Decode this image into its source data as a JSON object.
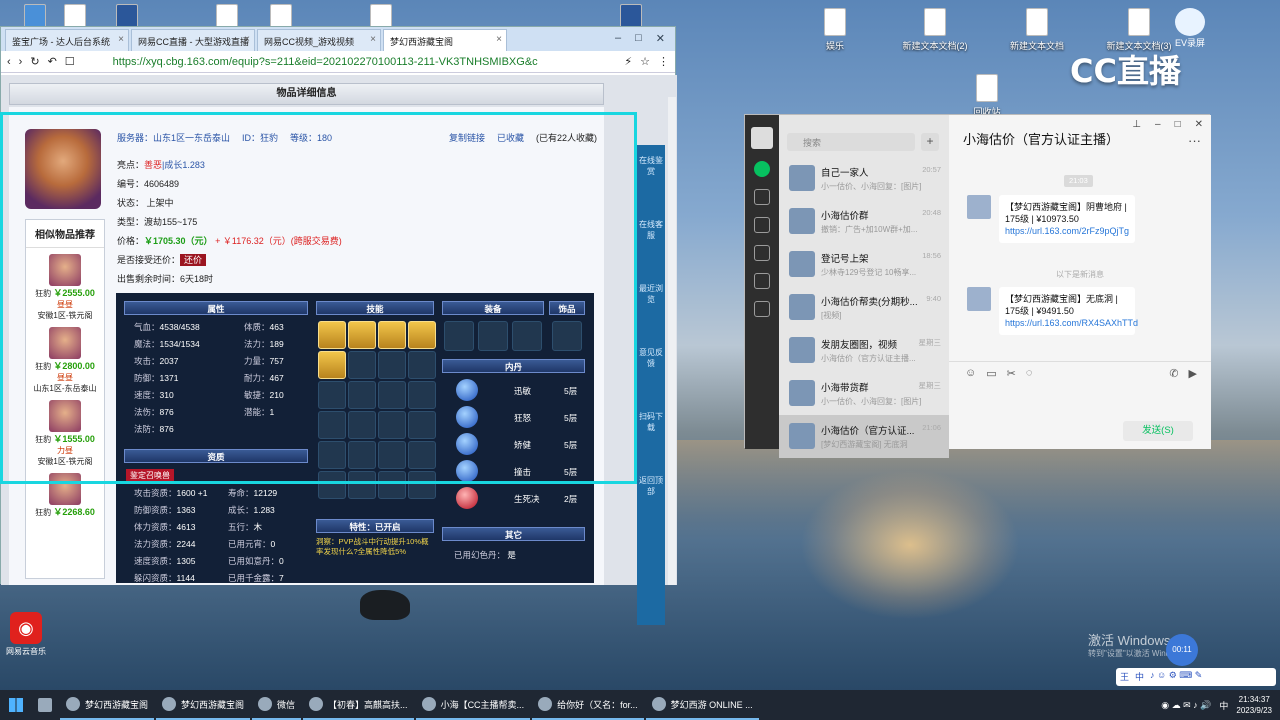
{
  "desktop": {
    "icons": [
      {
        "label": "",
        "x_note": "top-left row"
      },
      {
        "label": "娱乐"
      },
      {
        "label": "新建文本文档(2)"
      },
      {
        "label": "新建文本文档"
      },
      {
        "label": "新建文本文档(3)"
      },
      {
        "label": "EV录屏"
      },
      {
        "label": "回收站"
      }
    ],
    "cc_watermark": "CC直播",
    "netease_label": "网易云音乐",
    "activate_title": "激活 Windows",
    "activate_sub": "转到\"设置\"以激活 Windows。",
    "timer": "00:11"
  },
  "browser": {
    "tabs": [
      {
        "label": "鉴宝广场 - 达人后台系统"
      },
      {
        "label": "网易CC直播 - 大型游戏直播"
      },
      {
        "label": "网易CC视频_游戏视频"
      },
      {
        "label": "梦幻西游藏宝阁"
      }
    ],
    "url": "https://xyq.cbg.163.com/equip?s=211&eid=202102270100113-211-VK3TNHSMIBXG&c",
    "page_title": "物品详细信息",
    "server": "服务器：山东1区一东岳泰山",
    "id": "ID：狂豹",
    "level": "等级：180",
    "copy_link": "复制链接",
    "collected": "已收藏",
    "collect_count": "(已有22人收藏)",
    "highlight_label": "亮点：",
    "highlight_a": "善恶",
    "highlight_b": "|成长1.283",
    "code": "编号：4606489",
    "status": "状态：  上架中",
    "type": "类型：渡劫155~175",
    "price_label": "价格：",
    "price_main": "￥1705.30（元）",
    "price_plus": "+",
    "price_extra": "￥1176.32（元）(跨服交易费)",
    "bargain_label": "是否接受还价：",
    "bargain_btn": "还价",
    "remain": "出售剩余时间：6天18时",
    "similar": {
      "title": "相似物品推荐",
      "items": [
        {
          "name": "狂豹",
          "price": "￥2555.00",
          "tag": "昼昼",
          "server": "安徽1区-铁元阁"
        },
        {
          "name": "狂豹",
          "price": "￥2800.00",
          "tag": "昼昼",
          "server": "山东1区-东岳泰山"
        },
        {
          "name": "狂豹",
          "price": "￥1555.00",
          "tag": "力昼",
          "server": "安徽1区-铁元阁"
        },
        {
          "name": "狂豹",
          "price": "￥2268.60",
          "tag": "",
          "server": ""
        }
      ]
    },
    "panel": {
      "attr_head": "属性",
      "skill_head": "技能",
      "equip_head": "装备",
      "ornament_head": "饰品",
      "neidan_head": "内丹",
      "zizhi_head": "资质",
      "trait_head": "特性：已开启",
      "other_head": "其它",
      "attrs": [
        {
          "k": "气血：",
          "v": "4538/4538",
          "k2": "体质：",
          "v2": "463"
        },
        {
          "k": "魔法：",
          "v": "1534/1534",
          "k2": "法力：",
          "v2": "189"
        },
        {
          "k": "攻击：",
          "v": "2037",
          "k2": "力量：",
          "v2": "757"
        },
        {
          "k": "防御：",
          "v": "1371",
          "k2": "耐力：",
          "v2": "467"
        },
        {
          "k": "速度：",
          "v": "310",
          "k2": "敏捷：",
          "v2": "210"
        },
        {
          "k": "法伤：",
          "v": "876",
          "k2": "潜能：",
          "v2": "1"
        },
        {
          "k": "法防：",
          "v": "876",
          "k2": "",
          "v2": ""
        }
      ],
      "identify_btn": "鉴定召唤兽",
      "zizhi": [
        {
          "k": "攻击资质：",
          "v": "1600 +1",
          "k2": "寿命：",
          "v2": "12129"
        },
        {
          "k": "防御资质：",
          "v": "1363",
          "k2": "成长：",
          "v2": "1.283"
        },
        {
          "k": "体力资质：",
          "v": "4613",
          "k2": "五行：",
          "v2": "木"
        },
        {
          "k": "法力资质：",
          "v": "2244",
          "k2": "已用元宵：",
          "v2": "0"
        },
        {
          "k": "速度资质：",
          "v": "1305",
          "k2": "已用如意丹：",
          "v2": "0"
        },
        {
          "k": "躲闪资质：",
          "v": "1144",
          "k2": "已用千金露：",
          "v2": "7"
        }
      ],
      "neidan": [
        {
          "name": "迅敏",
          "level": "5层"
        },
        {
          "name": "狂怒",
          "level": "5层"
        },
        {
          "name": "矫健",
          "level": "5层"
        },
        {
          "name": "撞击",
          "level": "5层"
        },
        {
          "name": "生死决",
          "level": "2层"
        }
      ],
      "trait_text": "洞察：PVP战斗中行动提升10%概率发现什么?全属性降低5%",
      "other_k": "已用幻色丹：",
      "other_v": "是"
    },
    "floatbar": [
      {
        "label": "在线鉴赏"
      },
      {
        "label": "在线客服"
      },
      {
        "label": "最近浏览"
      },
      {
        "label": "意见反馈"
      },
      {
        "label": "扫码下载"
      },
      {
        "label": "返回顶部"
      }
    ]
  },
  "chat": {
    "search_placeholder": "搜索",
    "title": "小海估价（官方认证主播）",
    "conversations": [
      {
        "name": "自己一家人",
        "preview": "小一估价、小海回复：[图片]",
        "time": "20:57"
      },
      {
        "name": "小海估价群",
        "preview": "撤销：广告+加10W群+加...",
        "time": "20:48"
      },
      {
        "name": "登记号上架",
        "preview": "少林寺129号登记 10畅享...",
        "time": "18:56"
      },
      {
        "name": "小海估价帮卖(分期秒...",
        "preview": "[视频]",
        "time": "9:40"
      },
      {
        "name": "发朋友圈图，视频",
        "preview": "小海估价（官方认证主播...",
        "time": "星期三"
      },
      {
        "name": "小海带货群",
        "preview": "小一估价、小海回复：[图片]",
        "time": "星期三"
      },
      {
        "name": "小海估价（官方认证...",
        "preview": "[梦幻西游藏宝阁] 无底洞",
        "time": "21:06"
      }
    ],
    "time_stamp": "21:03",
    "messages": [
      {
        "text": "【梦幻西游藏宝阁】阴曹地府 | 175级 | ¥10973.50",
        "link": "https://url.163.com/2rFz9pQjTg"
      },
      {
        "text": "【梦幻西游藏宝阁】无底洞 | 175级 | ¥9491.50",
        "link": "https://url.163.com/RX4SAXhTTd"
      }
    ],
    "new_message_divider": "以下是新消息",
    "send_btn": "发送(S)"
  },
  "taskbar": {
    "items": [
      {
        "label": "梦幻西游藏宝阁"
      },
      {
        "label": "梦幻西游藏宝阁"
      },
      {
        "label": "微信"
      },
      {
        "label": "【初春】高麒高扶..."
      },
      {
        "label": "小海【CC主播帮卖..."
      },
      {
        "label": "给你好（又名：for..."
      },
      {
        "label": "梦幻西游 ONLINE ..."
      }
    ],
    "ime": "中",
    "time": "21:34:37",
    "date": "2023/9/23"
  }
}
